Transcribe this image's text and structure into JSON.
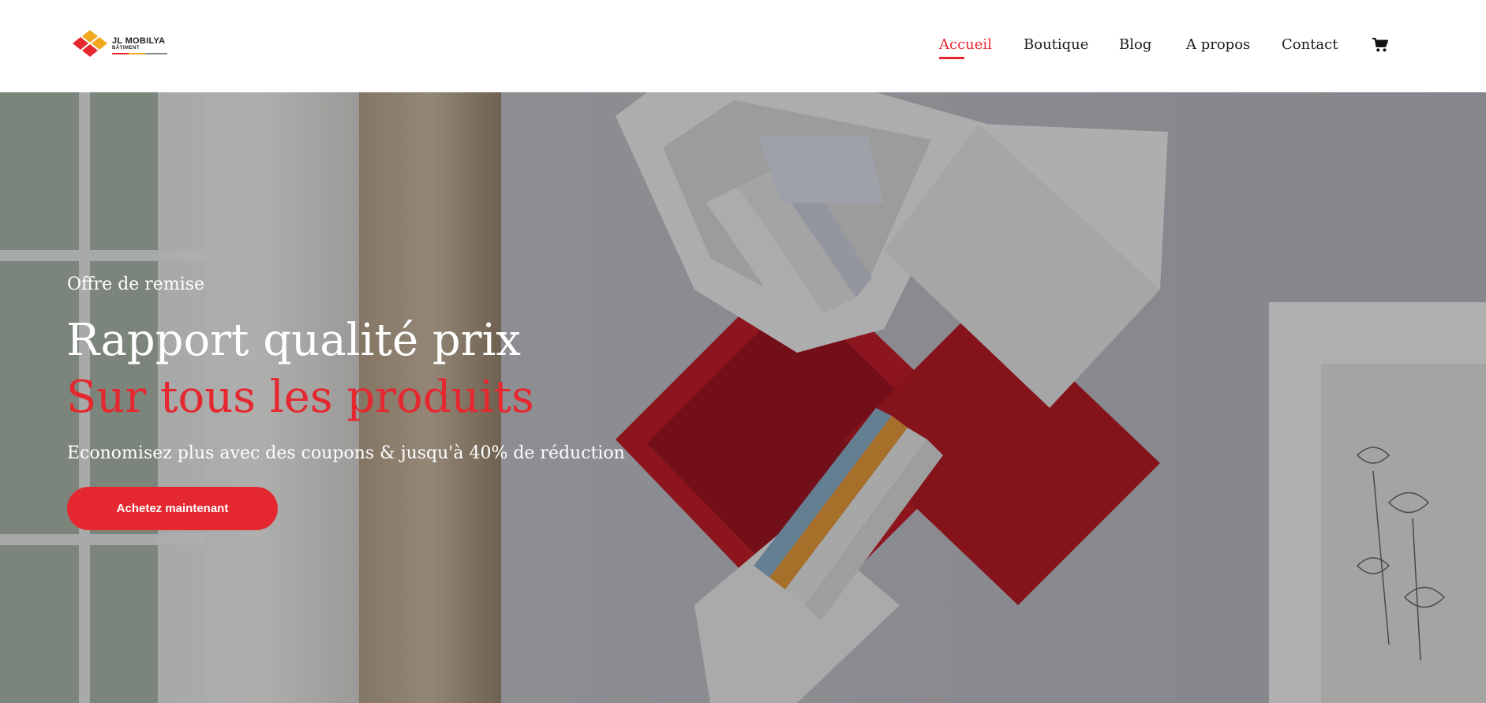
{
  "header": {
    "logo": {
      "brand": "JL MOBILYA",
      "sub": "BÂTIMENT"
    },
    "nav": [
      {
        "label": "Accueil",
        "active": true
      },
      {
        "label": "Boutique",
        "active": false
      },
      {
        "label": "Blog",
        "active": false
      },
      {
        "label": "A propos",
        "active": false
      },
      {
        "label": "Contact",
        "active": false
      }
    ],
    "cart_icon": "shopping-cart-icon"
  },
  "hero": {
    "eyebrow": "Offre de remise",
    "title_line1": "Rapport qualité prix",
    "title_line2": "Sur tous les produits",
    "subtitle": "Economisez plus avec des coupons & jusqu'à 40% de réduction",
    "cta_label": "Achetez maintenant"
  },
  "colors": {
    "accent": "#e5282f",
    "text_dark": "#1d1d1d",
    "logo_orange": "#f0a91f"
  }
}
